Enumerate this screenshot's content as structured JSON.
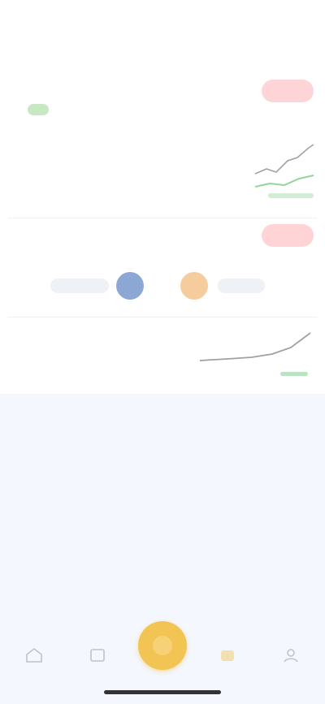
{
  "status_bar": {
    "time": "",
    "right": ""
  },
  "header": {
    "title": ""
  },
  "card1": {
    "title": "",
    "subtitle": "",
    "action_label": ""
  },
  "stats": {
    "lines": [
      "",
      "",
      "",
      "",
      ""
    ]
  },
  "section": {
    "label": "",
    "action_label": ""
  },
  "partners": {
    "pill_left": "",
    "pill_right": ""
  },
  "card2": {
    "title": "",
    "subtitle": "",
    "footer": ""
  },
  "tabbar": {
    "tabs": [
      {
        "label": ""
      },
      {
        "label": ""
      },
      {
        "label": ""
      },
      {
        "label": ""
      },
      {
        "label": ""
      }
    ]
  },
  "colors": {
    "accent_red": "#e45b67",
    "accent_red_bg": "#ffd4d7",
    "accent_green": "#38b24a",
    "accent_yellow": "#f2c453",
    "accent_blue": "#2f5fb0",
    "accent_orange": "#f0a24c",
    "page_bg": "#f4f7fd"
  },
  "icons": [
    "chart-line-icon",
    "center-action-icon",
    "home-icon",
    "list-icon",
    "wallet-icon",
    "profile-icon"
  ]
}
